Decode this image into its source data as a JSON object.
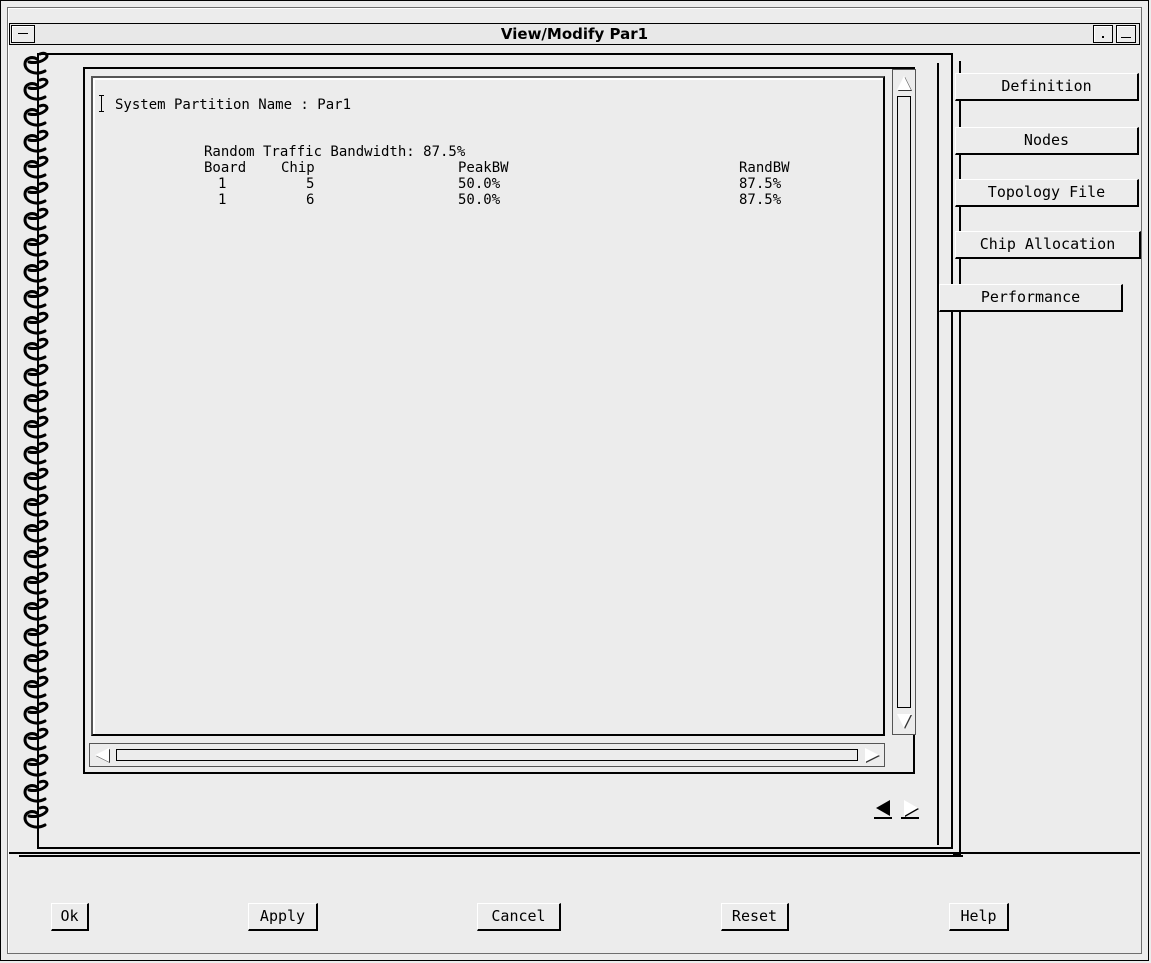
{
  "window": {
    "title": "View/Modify Par1"
  },
  "content": {
    "partition_line": "System Partition Name : Par1",
    "bandwidth_line": "Random Traffic Bandwidth: 87.5%",
    "headers": {
      "board": "Board",
      "chip": "Chip",
      "peak": "PeakBW",
      "rand": "RandBW"
    },
    "rows": [
      {
        "board": "1",
        "chip": "5",
        "peak": "50.0%",
        "rand": "87.5%"
      },
      {
        "board": "1",
        "chip": "6",
        "peak": "50.0%",
        "rand": "87.5%"
      }
    ]
  },
  "tabs": {
    "definition": "Definition",
    "nodes": "Nodes",
    "topology": "Topology File",
    "chip_allocation": "Chip Allocation",
    "performance": "Performance",
    "active": "performance"
  },
  "buttons": {
    "ok": "Ok",
    "apply": "Apply",
    "cancel": "Cancel",
    "reset": "Reset",
    "help": "Help"
  },
  "icons": {
    "window_menu": "window-menu-icon",
    "minimize": "minimize-icon",
    "maximize": "maximize-icon",
    "spiral_binding": "spiral-binding-icon",
    "scroll_up": "scroll-up-icon",
    "scroll_down": "scroll-down-icon",
    "scroll_left": "scroll-left-icon",
    "scroll_right": "scroll-right-icon",
    "prev_page": "prev-page-icon",
    "next_page": "next-page-icon"
  }
}
